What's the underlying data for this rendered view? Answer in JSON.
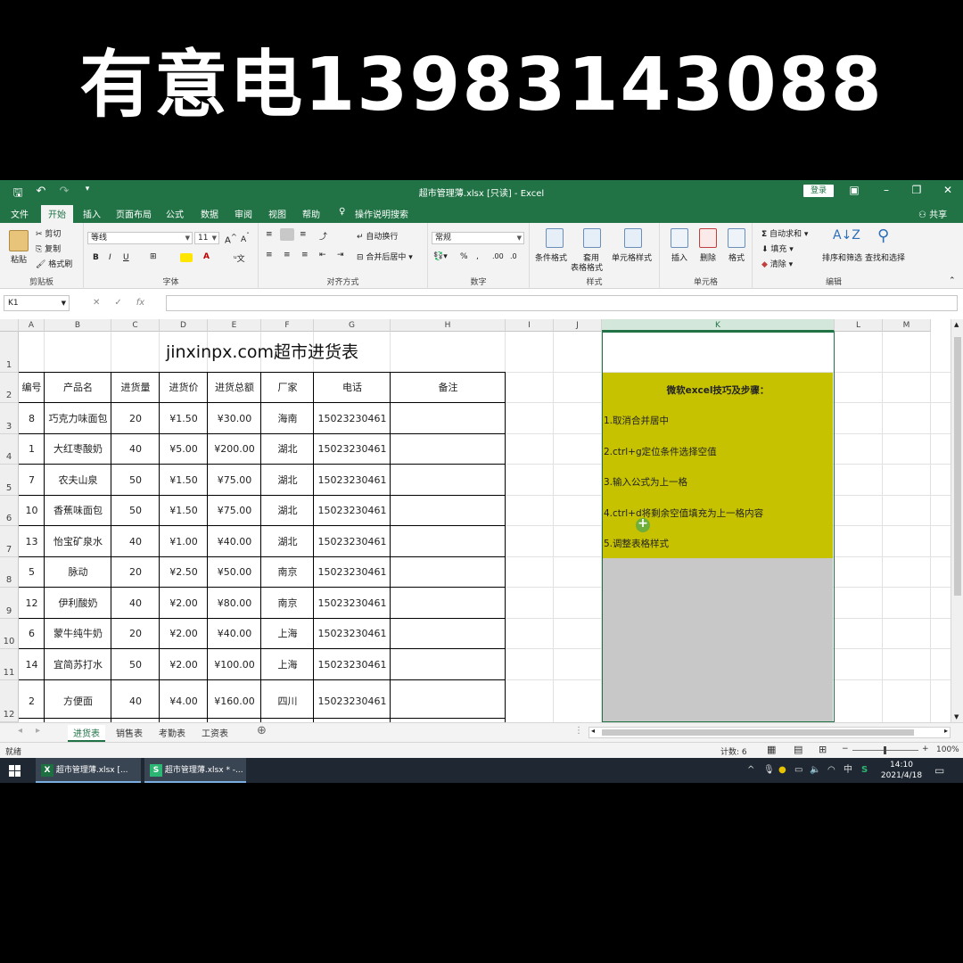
{
  "banner": "有意电13983143088",
  "window": {
    "title": "超市管理薄.xlsx  [只读]  -  Excel",
    "login_label": "登录",
    "share_label": "共享"
  },
  "ribbon_tabs": [
    "文件",
    "开始",
    "插入",
    "页面布局",
    "公式",
    "数据",
    "审阅",
    "视图",
    "帮助",
    "操作说明搜索"
  ],
  "ribbon": {
    "clipboard": {
      "paste": "粘贴",
      "cut": "剪切",
      "copy": "复制",
      "format_painter": "格式刷",
      "label": "剪贴板"
    },
    "font": {
      "name": "等线",
      "size": "11",
      "label": "字体"
    },
    "alignment": {
      "wrap": "自动换行",
      "merge": "合并后居中",
      "label": "对齐方式"
    },
    "number": {
      "format": "常规",
      "label": "数字"
    },
    "styles": {
      "conditional": "条件格式",
      "table_line1": "套用",
      "table_line2": "表格格式",
      "cell_styles": "单元格样式",
      "label": "样式"
    },
    "cells": {
      "insert": "插入",
      "delete": "删除",
      "format": "格式",
      "label": "单元格"
    },
    "editing": {
      "autosum": "自动求和",
      "fill": "填充",
      "clear": "清除",
      "sort": "排序和筛选",
      "find": "查找和选择",
      "label": "编辑"
    }
  },
  "formula_bar": {
    "name_box": "K1",
    "formula": ""
  },
  "columns": [
    "A",
    "B",
    "C",
    "D",
    "E",
    "F",
    "G",
    "H",
    "I",
    "J",
    "K",
    "L",
    "M"
  ],
  "rows": [
    "1",
    "2",
    "3",
    "4",
    "5",
    "6",
    "7",
    "8",
    "9",
    "10",
    "11",
    "12"
  ],
  "sheet": {
    "title": "jinxinpx.com超市进货表",
    "headers": [
      "编号",
      "产品名",
      "进货量",
      "进货价",
      "进货总额",
      "厂家",
      "电话",
      "备注"
    ],
    "data": [
      [
        "8",
        "巧克力味面包",
        "20",
        "¥1.50",
        "¥30.00",
        "海南",
        "15023230461",
        ""
      ],
      [
        "1",
        "大红枣酸奶",
        "40",
        "¥5.00",
        "¥200.00",
        "湖北",
        "15023230461",
        ""
      ],
      [
        "7",
        "农夫山泉",
        "50",
        "¥1.50",
        "¥75.00",
        "湖北",
        "15023230461",
        ""
      ],
      [
        "10",
        "香蕉味面包",
        "50",
        "¥1.50",
        "¥75.00",
        "湖北",
        "15023230461",
        ""
      ],
      [
        "13",
        "怡宝矿泉水",
        "40",
        "¥1.00",
        "¥40.00",
        "湖北",
        "15023230461",
        ""
      ],
      [
        "5",
        "脉动",
        "20",
        "¥2.50",
        "¥50.00",
        "南京",
        "15023230461",
        ""
      ],
      [
        "12",
        "伊利酸奶",
        "40",
        "¥2.00",
        "¥80.00",
        "南京",
        "15023230461",
        ""
      ],
      [
        "6",
        "蒙牛纯牛奶",
        "20",
        "¥2.00",
        "¥40.00",
        "上海",
        "15023230461",
        ""
      ],
      [
        "14",
        "宜简苏打水",
        "50",
        "¥2.00",
        "¥100.00",
        "上海",
        "15023230461",
        ""
      ],
      [
        "2",
        "方便面",
        "40",
        "¥4.00",
        "¥160.00",
        "四川",
        "15023230461",
        ""
      ]
    ]
  },
  "tips": {
    "title": "微软excel技巧及步骤：",
    "steps": [
      "1.取消合并居中",
      "2.ctrl+g定位条件选择空值",
      "3.输入公式为上一格",
      "4.ctrl+d将剩余空值填充为上一格内容",
      "5.调整表格样式"
    ]
  },
  "sheet_tabs": [
    "进货表",
    "销售表",
    "考勤表",
    "工资表"
  ],
  "status": {
    "ready": "就绪",
    "count": "计数: 6",
    "zoom": "100%"
  },
  "taskbar": {
    "items": [
      "超市管理薄.xlsx  [...",
      "超市管理薄.xlsx * -..."
    ],
    "ime": "中",
    "time": "14:10",
    "date": "2021/4/18"
  }
}
